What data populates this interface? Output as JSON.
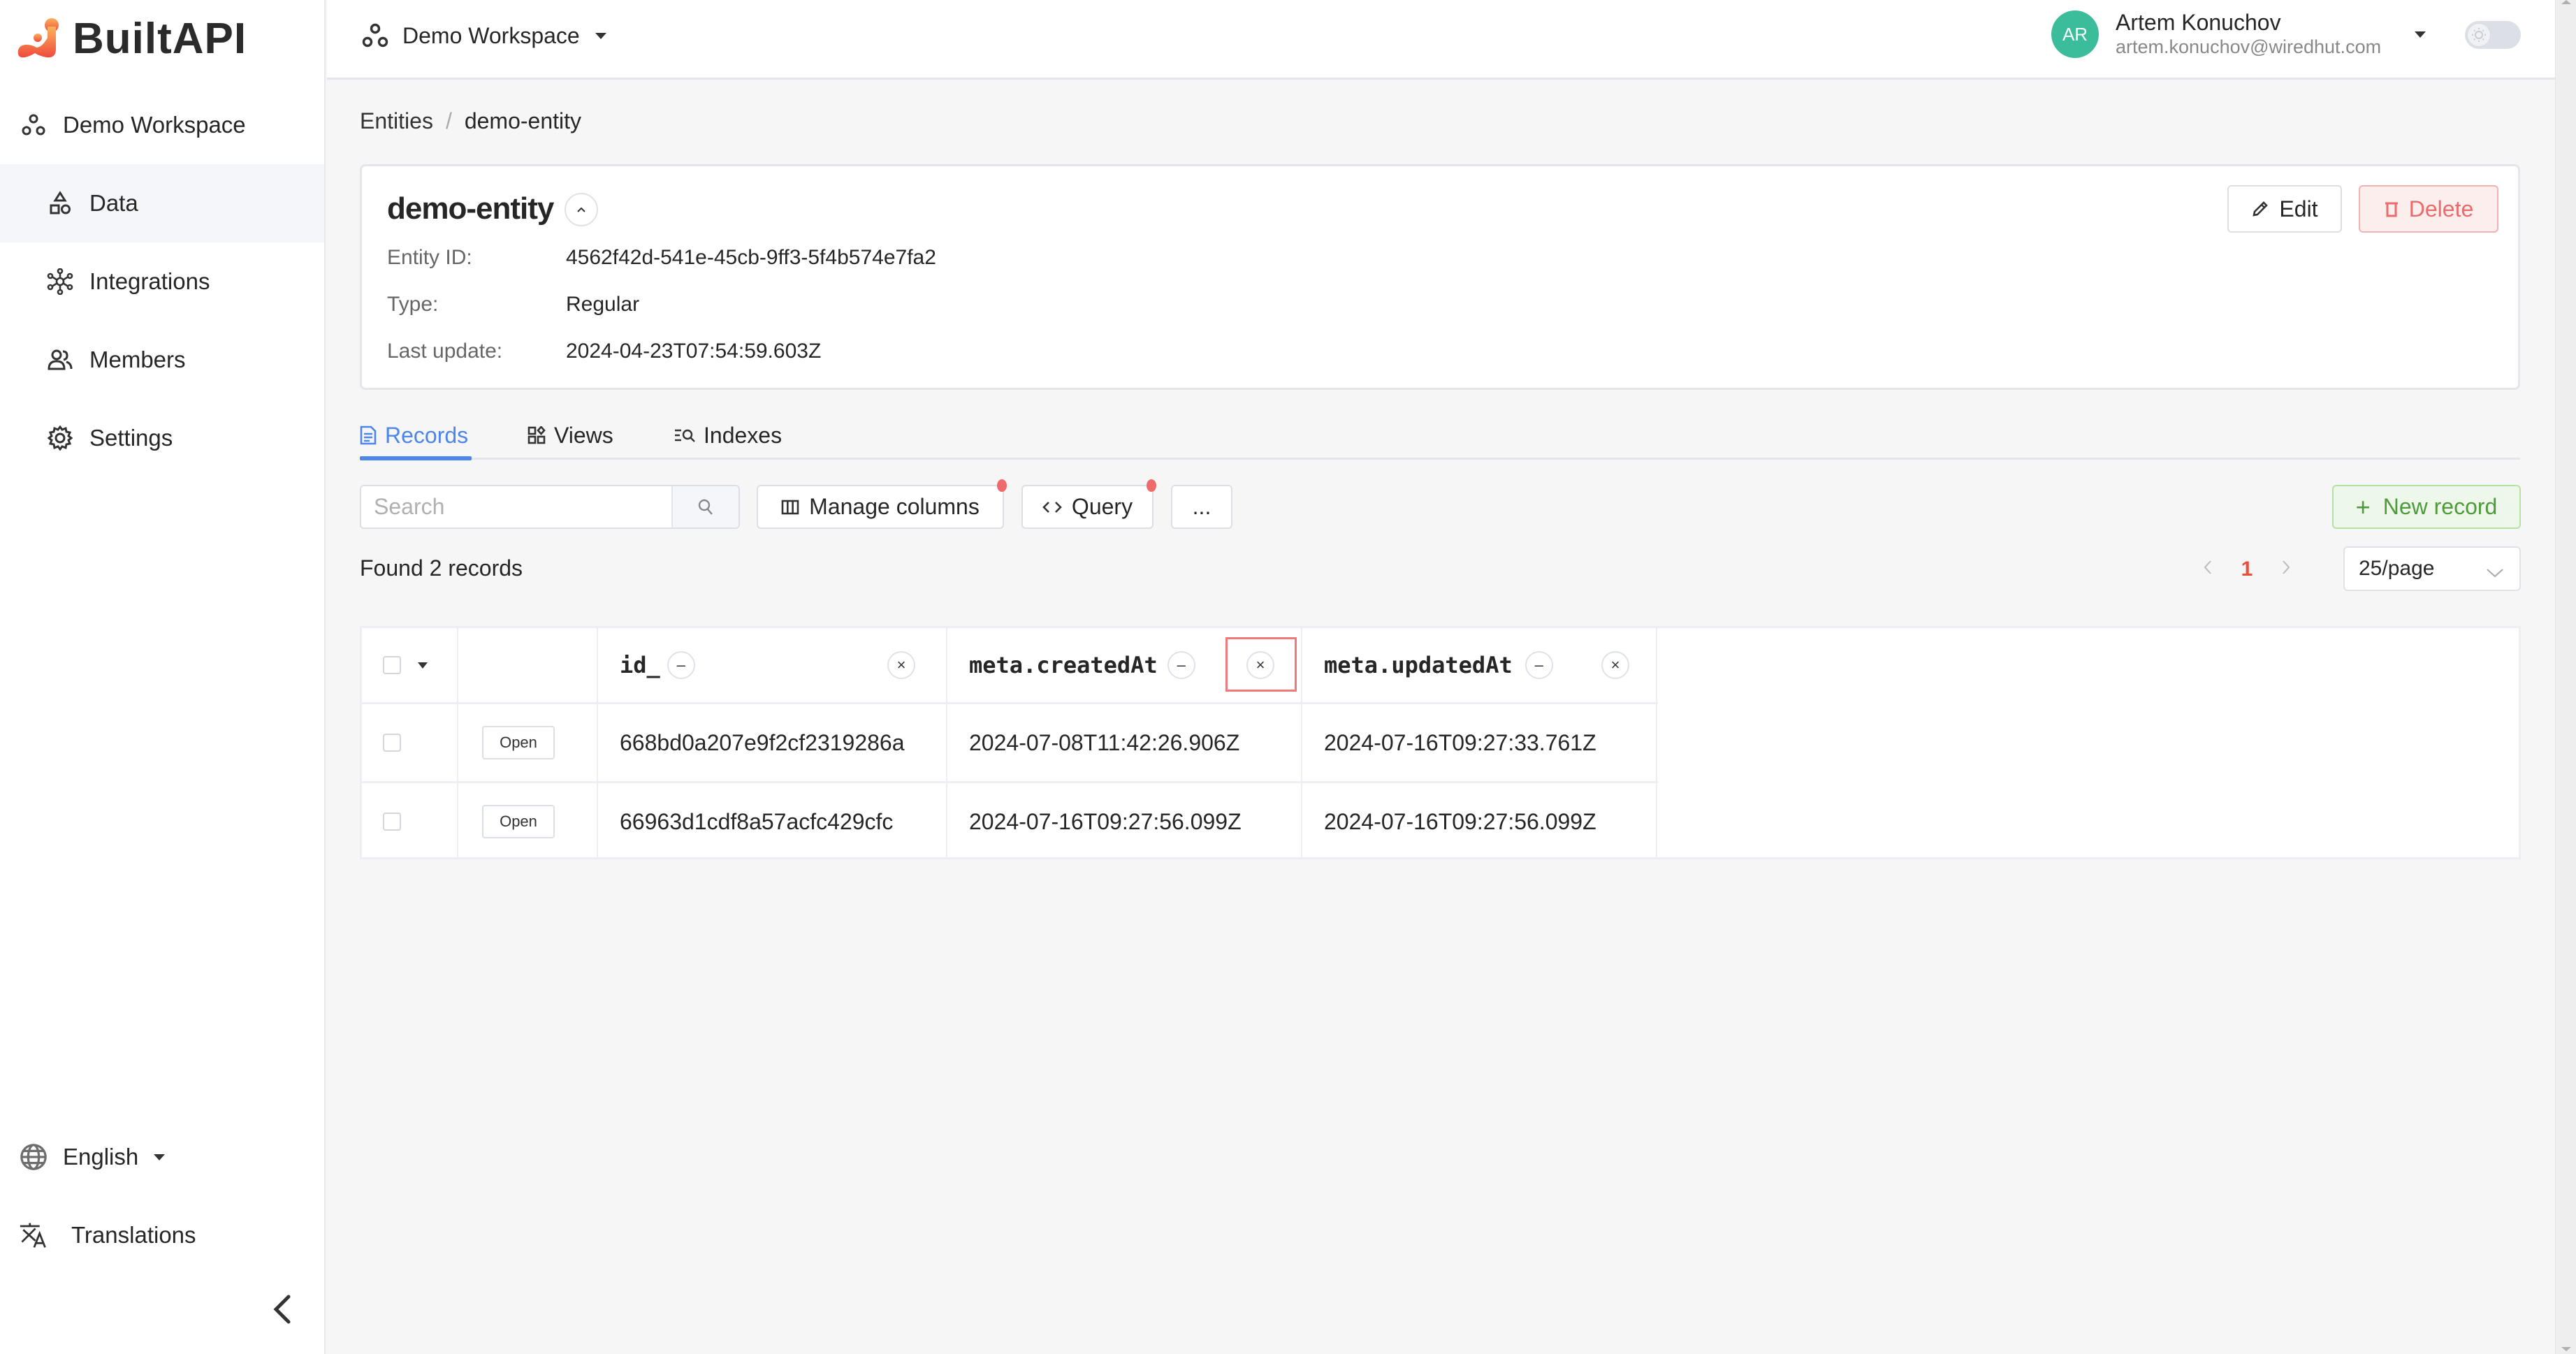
{
  "app": {
    "brand": "BuiltAPI",
    "accent": "#4c86e8",
    "brand_color": "#f06a3a"
  },
  "sidebar": {
    "workspace": "Demo Workspace",
    "items": [
      {
        "label": "Data",
        "icon": "shapes-icon",
        "active": true
      },
      {
        "label": "Integrations",
        "icon": "integrations-icon",
        "active": false
      },
      {
        "label": "Members",
        "icon": "members-icon",
        "active": false
      },
      {
        "label": "Settings",
        "icon": "gear-icon",
        "active": false
      }
    ],
    "language": "English",
    "translations": "Translations"
  },
  "header": {
    "workspace": "Demo Workspace",
    "user": {
      "initials": "AR",
      "name": "Artem Konuchov",
      "email": "artem.konuchov@wiredhut.com",
      "avatar_color": "#3bbc9b"
    }
  },
  "breadcrumb": {
    "items": [
      "Entities",
      "demo-entity"
    ],
    "separator": "/"
  },
  "entity": {
    "title": "demo-entity",
    "fields": [
      {
        "label": "Entity ID:",
        "value": "4562f42d-541e-45cb-9ff3-5f4b574e7fa2"
      },
      {
        "label": "Type:",
        "value": "Regular"
      },
      {
        "label": "Last update:",
        "value": "2024-04-23T07:54:59.603Z"
      }
    ],
    "edit_label": "Edit",
    "delete_label": "Delete"
  },
  "tabs": [
    {
      "label": "Records",
      "active": true
    },
    {
      "label": "Views",
      "active": false
    },
    {
      "label": "Indexes",
      "active": false
    }
  ],
  "toolbar": {
    "search_placeholder": "Search",
    "search_value": "",
    "manage_columns": "Manage columns",
    "query": "Query",
    "more": "...",
    "new_record": "New record"
  },
  "records": {
    "found_text": "Found 2 records",
    "current_page": "1",
    "page_size": "25/page",
    "columns": [
      "id_",
      "meta.createdAt",
      "meta.updatedAt"
    ],
    "open_label": "Open",
    "rows": [
      {
        "id_": "668bd0a207e9f2cf2319286a",
        "createdAt": "2024-07-08T11:42:26.906Z",
        "updatedAt": "2024-07-16T09:27:33.761Z"
      },
      {
        "id_": "66963d1cdf8a57acfc429cfc",
        "createdAt": "2024-07-16T09:27:56.099Z",
        "updatedAt": "2024-07-16T09:27:56.099Z"
      }
    ]
  }
}
